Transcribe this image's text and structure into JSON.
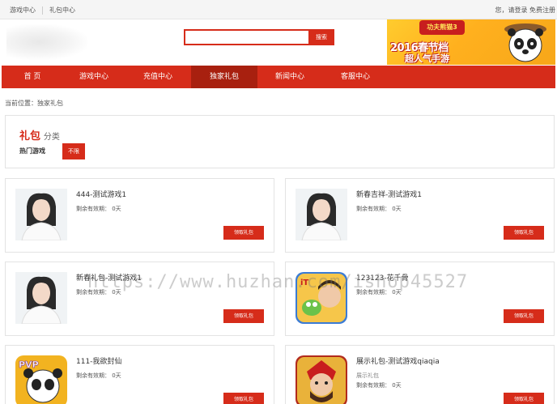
{
  "topbar": {
    "links": [
      "游戏中心",
      "礼包中心"
    ],
    "right_text": "您，请登录 免费注册"
  },
  "search": {
    "value": "",
    "placeholder": "",
    "button_label": "搜索"
  },
  "banner": {
    "hat_text": "功夫熊猫3",
    "line1": "2016春节档",
    "line2": "超人气手游"
  },
  "nav": {
    "items": [
      "首 页",
      "游戏中心",
      "充值中心",
      "独家礼包",
      "新闻中心",
      "客服中心"
    ],
    "active": "独家礼包"
  },
  "breadcrumb": "当前位置：独家礼包",
  "category": {
    "title_strong": "礼包",
    "title_rest": "分类",
    "hot_label": "热门游戏",
    "filter_tag": "不限"
  },
  "cards": [
    {
      "name": "444-测试游戏1",
      "sub": "",
      "validity": "剩余有效期：  0天",
      "button": "领取礼包",
      "thumb": "woman-portrait-icon"
    },
    {
      "name": "新春吉祥-测试游戏1",
      "sub": "",
      "validity": "剩余有效期：  0天",
      "button": "领取礼包",
      "thumb": "woman-portrait-icon"
    },
    {
      "name": "新春礼包-测试游戏1",
      "sub": "",
      "validity": "剩余有效期：  0天",
      "button": "领取礼包",
      "thumb": "woman-portrait-icon"
    },
    {
      "name": "123123-花千骨",
      "sub": "",
      "validity": "剩余有效期：  0天",
      "button": "领取礼包",
      "thumb": "game-character-icon"
    },
    {
      "name": "111-我欲封仙",
      "sub": "",
      "validity": "剩余有效期：  0天",
      "button": "领取礼包",
      "thumb": "pvp-panda-game-icon"
    },
    {
      "name": "展示礼包-测试游戏qiaqia",
      "sub": "展示礼包",
      "validity": "剩余有效期：  0天",
      "button": "领取礼包",
      "thumb": "warrior-game-icon"
    }
  ],
  "watermark": "https://www.huzhan.com/ishop45527",
  "colors": {
    "accent": "#d62c1a",
    "accent_dark": "#a8200f",
    "border": "#e3e3e3"
  }
}
